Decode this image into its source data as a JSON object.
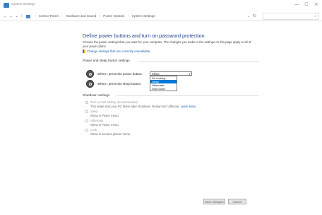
{
  "window": {
    "title": "System Settings",
    "controls": [
      "—",
      "☐",
      "✕"
    ]
  },
  "address": {
    "breadcrumbs": [
      "Control Panel",
      "Hardware and Sound",
      "Power Options",
      "System Settings"
    ],
    "dropdown_glyph": "⌄",
    "refresh_glyph": "↻",
    "search_placeholder": "",
    "search_icon": "search-icon"
  },
  "page": {
    "heading": "Define power buttons and turn on password protection",
    "description": "Choose the power settings that you want for your computer. The changes you make to the settings on this page apply to all of your power plans.",
    "unavailable_link": "Change settings that are currently unavailable"
  },
  "power_section": {
    "title": "Power and sleep button settings",
    "power_button_label": "When I press the power button:",
    "power_button_value": "Sleep",
    "sleep_button_label": "When I press the sleep button:",
    "options": [
      "Do nothing",
      "Sleep",
      "Hibernate",
      "Shut down"
    ],
    "selected_option": "Sleep"
  },
  "shutdown_section": {
    "title": "Shutdown settings",
    "items": [
      {
        "label": "Turn on fast startup (recommended)",
        "description": "This helps start your PC faster after shutdown. Restart isn't affected.",
        "link": "Learn More"
      },
      {
        "label": "Sleep",
        "description": "Show in Power menu."
      },
      {
        "label": "Hibernate",
        "description": "Show in Power menu."
      },
      {
        "label": "Lock",
        "description": "Show in account picture menu."
      }
    ]
  },
  "footer": {
    "save": "Save changes",
    "cancel": "Cancel"
  },
  "colors": {
    "heading": "#1e3f8a",
    "link": "#1a5fb4",
    "selection": "#0078d7"
  }
}
